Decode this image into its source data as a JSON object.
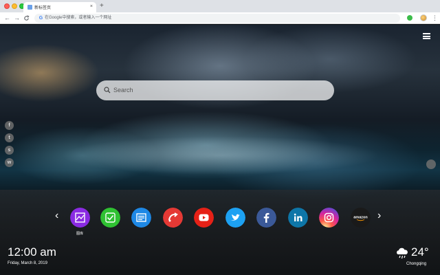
{
  "browser": {
    "tab_title": "新标签页",
    "tab_close": "×",
    "new_tab": "+",
    "omnibox_placeholder": "在Google中搜索，或者输入一个网址",
    "menu": "⋮",
    "back": "←",
    "forward": "→",
    "reload": "C"
  },
  "search": {
    "placeholder": "Search"
  },
  "social": {
    "icons": [
      "facebook-icon",
      "twitter-icon",
      "snapchat-icon",
      "wechat-icon"
    ]
  },
  "apps": {
    "items": [
      {
        "name": "photo-app-icon",
        "color": "#8a2be2",
        "label": "图库"
      },
      {
        "name": "green-check-app-icon",
        "color": "#2fc132"
      },
      {
        "name": "blue-document-app-icon",
        "color": "#1e88e5"
      },
      {
        "name": "red-arrow-app-icon",
        "color": "#e53935"
      },
      {
        "name": "youtube-icon",
        "color": "#e62117"
      },
      {
        "name": "twitter-icon",
        "color": "#1da1f2"
      },
      {
        "name": "facebook-icon",
        "color": "#3b5998"
      },
      {
        "name": "linkedin-icon",
        "color": "#0e76a8"
      },
      {
        "name": "instagram-icon",
        "color": "#d6249f"
      },
      {
        "name": "amazon-icon",
        "color": "#1a1a1a",
        "text": "amazon"
      }
    ],
    "prev": "‹",
    "next": "›"
  },
  "clock": {
    "time": "12:00 am",
    "date": "Friday, March 8, 2019"
  },
  "weather": {
    "temp": "24°",
    "city": "Chongqing",
    "condition_icon": "cloud-rain-icon"
  }
}
